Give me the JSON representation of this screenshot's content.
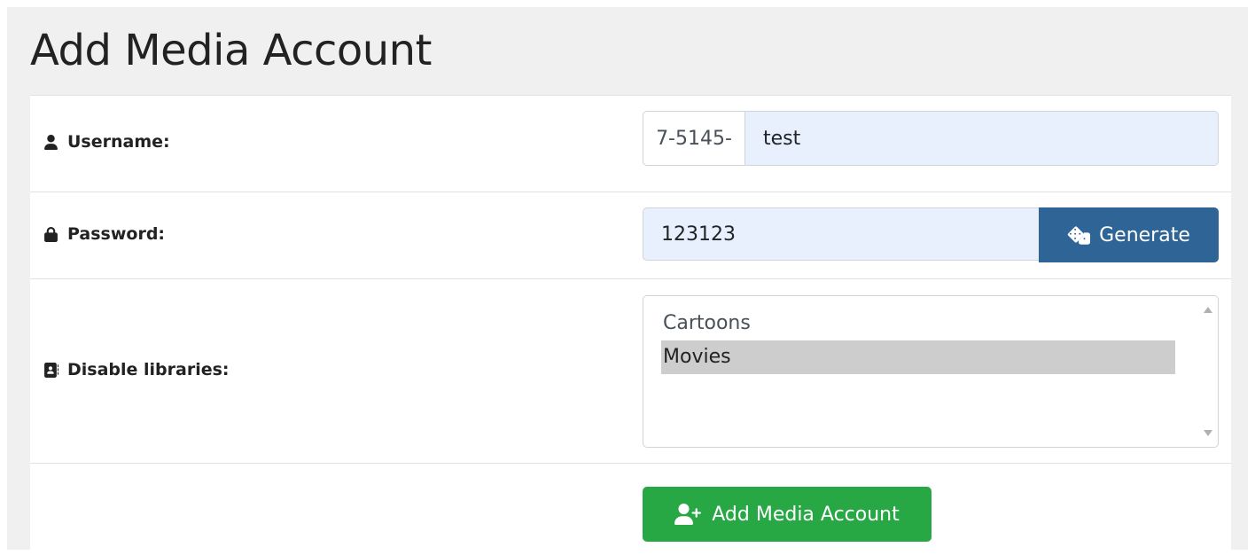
{
  "page": {
    "title": "Add Media Account"
  },
  "form": {
    "username": {
      "label": "Username:",
      "icon": "user-icon",
      "prefix": "7-5145-",
      "value": "test"
    },
    "password": {
      "label": "Password:",
      "icon": "lock-icon",
      "value": "123123",
      "generate_label": "Generate",
      "generate_icon": "dice-icon"
    },
    "libraries": {
      "label": "Disable libraries:",
      "icon": "address-book-icon",
      "options": [
        {
          "label": "Cartoons",
          "selected": false
        },
        {
          "label": "Movies",
          "selected": true
        }
      ]
    },
    "submit": {
      "label": "Add Media Account",
      "icon": "user-plus-icon"
    }
  },
  "colors": {
    "generate_button": "#2f6497",
    "submit_button": "#28a745",
    "autofill_input": "#e8f0fe",
    "selected_option": "#cdcdcd"
  }
}
